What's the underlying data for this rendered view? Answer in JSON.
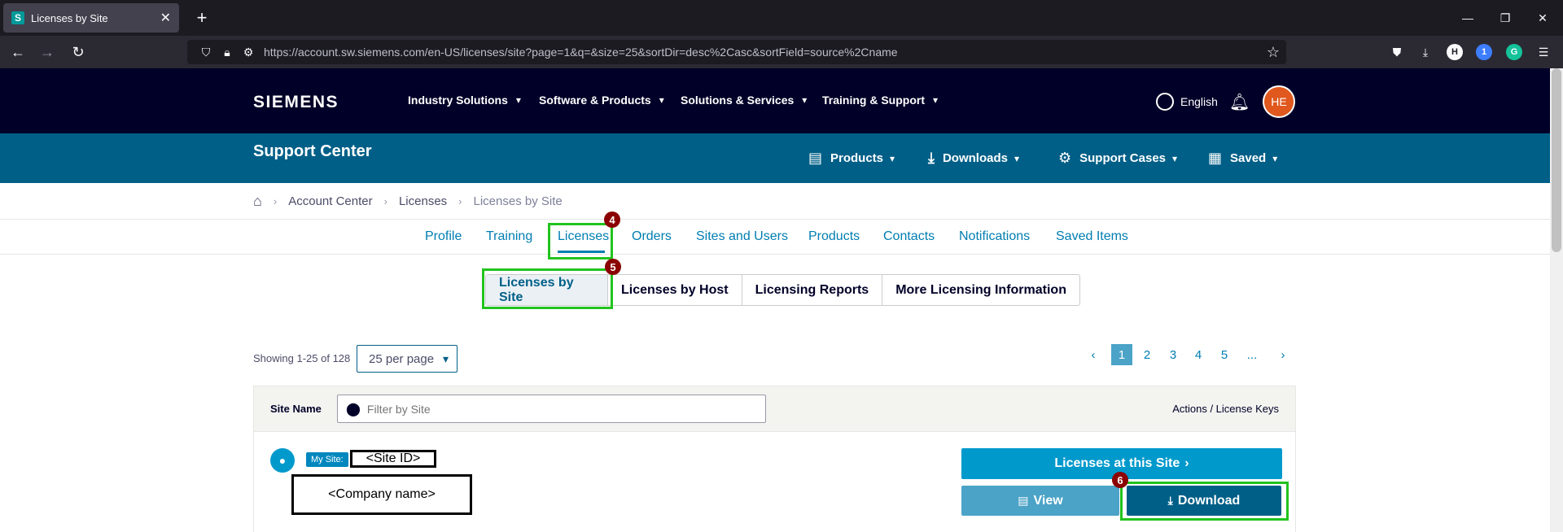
{
  "browser": {
    "tab_title": "Licenses by Site",
    "tab_favicon": "S",
    "url": "https://account.sw.siemens.com/en-US/licenses/site?page=1&q=&size=25&sortDir=desc%2Casc&sortField=source%2Cname",
    "extensions": [
      "pocket-icon",
      "download-icon",
      "h-extension-icon",
      "one-extension-icon",
      "grammarly-icon",
      "menu-icon"
    ]
  },
  "header": {
    "logo": "SIEMENS",
    "nav": [
      "Industry Solutions",
      "Software & Products",
      "Solutions & Services",
      "Training & Support"
    ],
    "language": "English",
    "avatar_initials": "HE",
    "brand_color": "#000028"
  },
  "support_bar": {
    "title": "Support Center",
    "menus": [
      "Products",
      "Downloads",
      "Support Cases",
      "Saved"
    ],
    "color": "#005f87"
  },
  "breadcrumb": [
    "Account Center",
    "Licenses",
    "Licenses by Site"
  ],
  "subnav": {
    "items": [
      "Profile",
      "Training",
      "Licenses",
      "Orders",
      "Sites and Users",
      "Products",
      "Contacts",
      "Notifications",
      "Saved Items"
    ],
    "active": "Licenses"
  },
  "license_tabs": {
    "items": [
      "Licenses by Site",
      "Licenses by Host",
      "Licensing Reports",
      "More Licensing Information"
    ],
    "active": "Licenses by Site"
  },
  "annotations": {
    "marker_4": "4",
    "marker_5": "5",
    "marker_6": "6",
    "highlight_color": "#22c31e",
    "marker_color": "#8b0000"
  },
  "listing": {
    "showing": "Showing 1-25 of 128",
    "per_page": "25 per page",
    "pages": [
      "1",
      "2",
      "3",
      "4",
      "5",
      "..."
    ],
    "current_page": "1"
  },
  "table": {
    "site_name_label": "Site Name",
    "filter_placeholder": "Filter by Site",
    "actions_label": "Actions / License Keys",
    "row": {
      "my_site_badge": "My Site:",
      "site_id": "<Site ID>",
      "company_name": "<Company name>",
      "licenses_button": "Licenses at this Site",
      "view_button": "View",
      "download_button": "Download"
    }
  }
}
